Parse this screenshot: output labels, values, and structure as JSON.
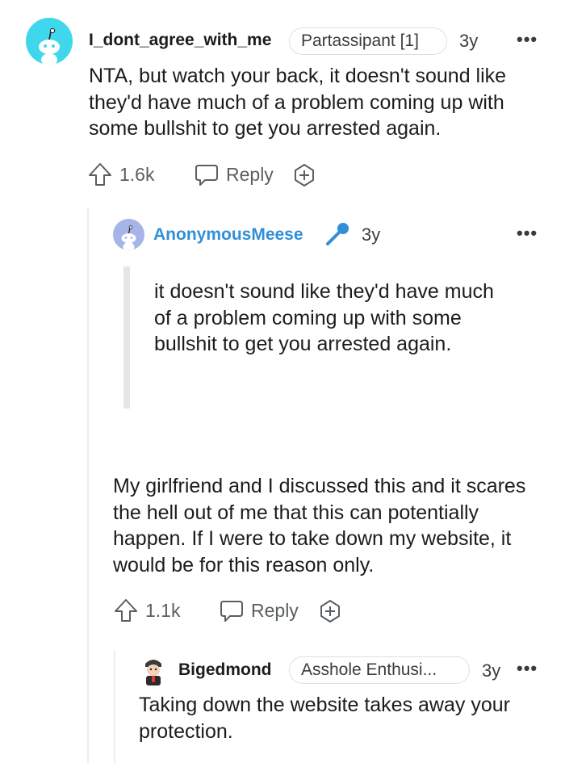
{
  "comments": [
    {
      "username": "I_dont_agree_with_me",
      "flair": "Partassipant [1]",
      "age": "3y",
      "more": "•••",
      "body": "NTA, but watch your back, it doesn't sound like they'd have much of a problem coming up with some bullshit to get you arrested again.",
      "votes": "1.6k",
      "reply_label": "Reply"
    },
    {
      "username": "AnonymousMeese",
      "username_color": "#2f8fd8",
      "age": "3y",
      "more": "•••",
      "quote": "it doesn't sound like they'd have much of a problem coming up with some bullshit to get you arrested again.",
      "body": "My girlfriend and I discussed this and it scares the hell out of me that this can potentially happen. If I were to take down my website, it would be for this reason only.",
      "votes": "1.1k",
      "reply_label": "Reply"
    },
    {
      "username": "Bigedmond",
      "flair": "Asshole Enthusi...",
      "age": "3y",
      "more": "•••",
      "body": "Taking down the website takes away your protection."
    }
  ],
  "colors": {
    "accent_blue": "#2f8fd8",
    "avatar_cyan": "#3fd7ec",
    "text_dark": "#1c1c1c",
    "text_muted": "#5a5f63"
  },
  "icons": [
    "snoo-avatar",
    "upvote-icon",
    "reply-bubble-icon",
    "award-icon",
    "mic-icon",
    "more-options-icon"
  ]
}
